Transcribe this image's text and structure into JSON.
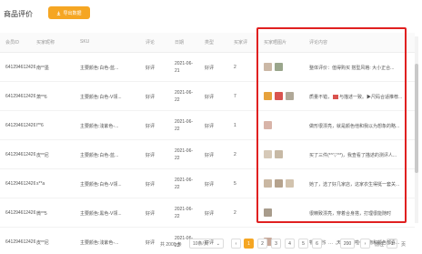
{
  "header": {
    "title": "商品评价",
    "export_label": "导出数据"
  },
  "columns": [
    "会员ID",
    "买家昵称",
    "SKU",
    "评论",
    "日期",
    "类型",
    "买家评",
    "买家晒图片",
    "评论内容"
  ],
  "rows": [
    {
      "id": "641294612426",
      "nick": "南**墨",
      "sku": "主要颜色:白色-蓝...",
      "review": "好评",
      "date1": "2021-06-",
      "date2": "21",
      "type": "好评",
      "count": "2",
      "content": "整体评价：值得购买 搭型风格: 大小正合...",
      "thumbs": [
        "#cbb8a6",
        "#9aa68c"
      ],
      "tag": false
    },
    {
      "id": "641294612426",
      "nick": "萧**6",
      "sku": "主要颜色:白色-V领...",
      "review": "好评",
      "date1": "2021-06-",
      "date2": "22",
      "type": "好评",
      "count": "7",
      "content": "质量不错，",
      "content2": "与描述一致。▶尺码合适推荐...",
      "thumbs": [
        "#e6a23c",
        "#d9534f",
        "#b0a898"
      ],
      "tag": true
    },
    {
      "id": "641294612426",
      "nick": "l**6",
      "sku": "主要颜色:浅紫色-...",
      "review": "好评",
      "date1": "2021-06-",
      "date2": "22",
      "type": "好评",
      "count": "1",
      "content": "做形很漂亮，就是颜色他和我以为想象的略...",
      "thumbs": [
        "#d8b4a8"
      ],
      "tag": false
    },
    {
      "id": "641294612426",
      "nick": "皮**尼",
      "sku": "主要颜色:白色-蓝...",
      "review": "好评",
      "date1": "2021-06-",
      "date2": "22",
      "type": "好评",
      "count": "2",
      "content": "买了三件(*^▽^*)，我查看了描述的测评人...",
      "thumbs": [
        "#d6c9b8",
        "#c7b9a5"
      ],
      "tag": false
    },
    {
      "id": "641294612426",
      "nick": "s**a",
      "sku": "主要颜色:白色-V领...",
      "review": "好评",
      "date1": "2021-06-",
      "date2": "22",
      "type": "好评",
      "count": "5",
      "content": "她了，选了好几家店，这家衣生得挺一套关...",
      "thumbs": [
        "#c9b7a2",
        "#b5a28d",
        "#d2c3ae"
      ],
      "tag": false
    },
    {
      "id": "641294612426",
      "nick": "微**5",
      "sku": "主要颜色:黑色-V领...",
      "review": "好评",
      "date1": "2021-06-",
      "date2": "22",
      "type": "好评",
      "count": "2",
      "content": "很精致漂亮，穿着合身搭，打理很能随时",
      "thumbs": [
        "#a89c8c"
      ],
      "tag": false
    },
    {
      "id": "641294612426",
      "nick": "皮**尼",
      "sku": "主要颜色:浅紫色-...",
      "review": "好评",
      "date1": "2021-06-",
      "date2": "22",
      "type": "好评",
      "count": "2",
      "content": "物流很快，几天就收到啦～实物和颜色都喜...",
      "thumbs": [
        "#c8a99a"
      ],
      "tag": false
    }
  ],
  "pager": {
    "total": "共 2000 条",
    "size": "10条/页",
    "size_caret": "⌄",
    "prev": "‹",
    "pages": [
      "1",
      "2",
      "3",
      "4",
      "5",
      "6",
      "···",
      "200"
    ],
    "next": "›",
    "goto_label": "前往",
    "goto_value": "1",
    "goto_unit": "页"
  }
}
